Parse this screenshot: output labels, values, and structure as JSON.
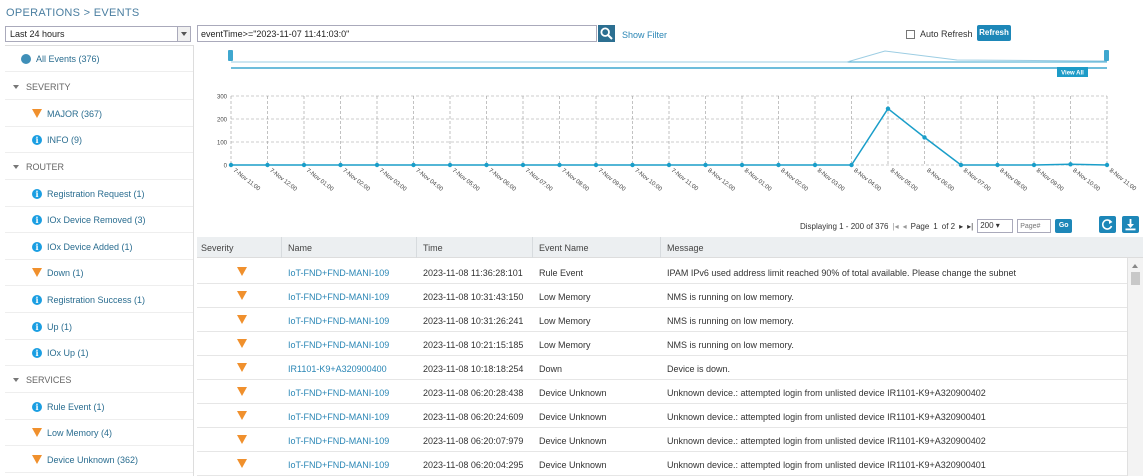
{
  "breadcrumb": "OPERATIONS > EVENTS",
  "time_range": "Last 24 hours",
  "query": "eventTime>=\"2023-11-07 11:41:03:0\"",
  "show_filter": "Show Filter",
  "auto_refresh": "Auto Refresh",
  "refresh": "Refresh",
  "view_all": "View All",
  "sidebar": {
    "all_events": "All Events (376)",
    "sections": [
      {
        "label": "SEVERITY",
        "items": [
          {
            "label": "MAJOR (367)",
            "icon": "major-warning-icon"
          },
          {
            "label": "INFO (9)",
            "icon": "info-icon"
          }
        ]
      },
      {
        "label": "ROUTER",
        "items": [
          {
            "label": "Registration Request (1)",
            "icon": "info-icon"
          },
          {
            "label": "IOx Device Removed (3)",
            "icon": "info-icon"
          },
          {
            "label": "IOx Device Added (1)",
            "icon": "info-icon"
          },
          {
            "label": "Down (1)",
            "icon": "major-warning-icon"
          },
          {
            "label": "Registration Success (1)",
            "icon": "info-icon"
          },
          {
            "label": "Up (1)",
            "icon": "info-icon"
          },
          {
            "label": "IOx Up (1)",
            "icon": "info-icon"
          }
        ]
      },
      {
        "label": "SERVICES",
        "items": [
          {
            "label": "Rule Event (1)",
            "icon": "info-icon"
          },
          {
            "label": "Low Memory (4)",
            "icon": "major-warning-icon"
          },
          {
            "label": "Device Unknown (362)",
            "icon": "major-warning-icon"
          }
        ]
      }
    ]
  },
  "chart_data": {
    "type": "line",
    "x": [
      "7-Nov 11:00",
      "7-Nov 12:00",
      "7-Nov 01:00",
      "7-Nov 02:00",
      "7-Nov 03:00",
      "7-Nov 04:00",
      "7-Nov 05:00",
      "7-Nov 06:00",
      "7-Nov 07:00",
      "7-Nov 08:00",
      "7-Nov 09:00",
      "7-Nov 10:00",
      "7-Nov 11:00",
      "8-Nov 12:00",
      "8-Nov 01:00",
      "8-Nov 02:00",
      "8-Nov 03:00",
      "8-Nov 04:00",
      "8-Nov 05:00",
      "8-Nov 06:00",
      "8-Nov 07:00",
      "8-Nov 08:00",
      "8-Nov 09:00",
      "8-Nov 10:00",
      "8-Nov 11:00"
    ],
    "values": [
      0,
      0,
      0,
      0,
      0,
      0,
      0,
      0,
      0,
      0,
      0,
      0,
      0,
      0,
      0,
      0,
      0,
      0,
      245,
      120,
      0,
      0,
      0,
      3,
      0
    ],
    "yticks": [
      "0",
      "100",
      "200",
      "300"
    ],
    "ylim": [
      0,
      300
    ],
    "grid": true,
    "color": "#1a9ec9"
  },
  "pagination": {
    "displaying": "Displaying 1 - 200 of 376",
    "page_label": "Page",
    "page": "1",
    "of": "of 2",
    "page_size": "200",
    "page_input_placeholder": "Page#",
    "go": "Go"
  },
  "table": {
    "headers": [
      "Severity",
      "Name",
      "Time",
      "Event Name",
      "Message"
    ],
    "rows": [
      {
        "name": "IoT-FND+FND-MANI-109",
        "time": "2023-11-08 11:36:28:101",
        "event": "Rule Event",
        "message": "IPAM IPv6 used address limit reached 90% of total available. Please change the subnet"
      },
      {
        "name": "IoT-FND+FND-MANI-109",
        "time": "2023-11-08 10:31:43:150",
        "event": "Low Memory",
        "message": "NMS is running on low memory."
      },
      {
        "name": "IoT-FND+FND-MANI-109",
        "time": "2023-11-08 10:31:26:241",
        "event": "Low Memory",
        "message": "NMS is running on low memory."
      },
      {
        "name": "IoT-FND+FND-MANI-109",
        "time": "2023-11-08 10:21:15:185",
        "event": "Low Memory",
        "message": "NMS is running on low memory."
      },
      {
        "name": "IR1101-K9+A320900400",
        "time": "2023-11-08 10:18:18:254",
        "event": "Down",
        "message": "Device is down."
      },
      {
        "name": "IoT-FND+FND-MANI-109",
        "time": "2023-11-08 06:20:28:438",
        "event": "Device Unknown",
        "message": "Unknown device.: attempted login from unlisted device IR1101-K9+A320900402"
      },
      {
        "name": "IoT-FND+FND-MANI-109",
        "time": "2023-11-08 06:20:24:609",
        "event": "Device Unknown",
        "message": "Unknown device.: attempted login from unlisted device IR1101-K9+A320900401"
      },
      {
        "name": "IoT-FND+FND-MANI-109",
        "time": "2023-11-08 06:20:07:979",
        "event": "Device Unknown",
        "message": "Unknown device.: attempted login from unlisted device IR1101-K9+A320900402"
      },
      {
        "name": "IoT-FND+FND-MANI-109",
        "time": "2023-11-08 06:20:04:295",
        "event": "Device Unknown",
        "message": "Unknown device.: attempted login from unlisted device IR1101-K9+A320900401"
      }
    ]
  },
  "colors": {
    "accent": "#1d87b8",
    "link": "#2a86b5",
    "major": "#f0902d",
    "info": "#1a9ee2"
  }
}
